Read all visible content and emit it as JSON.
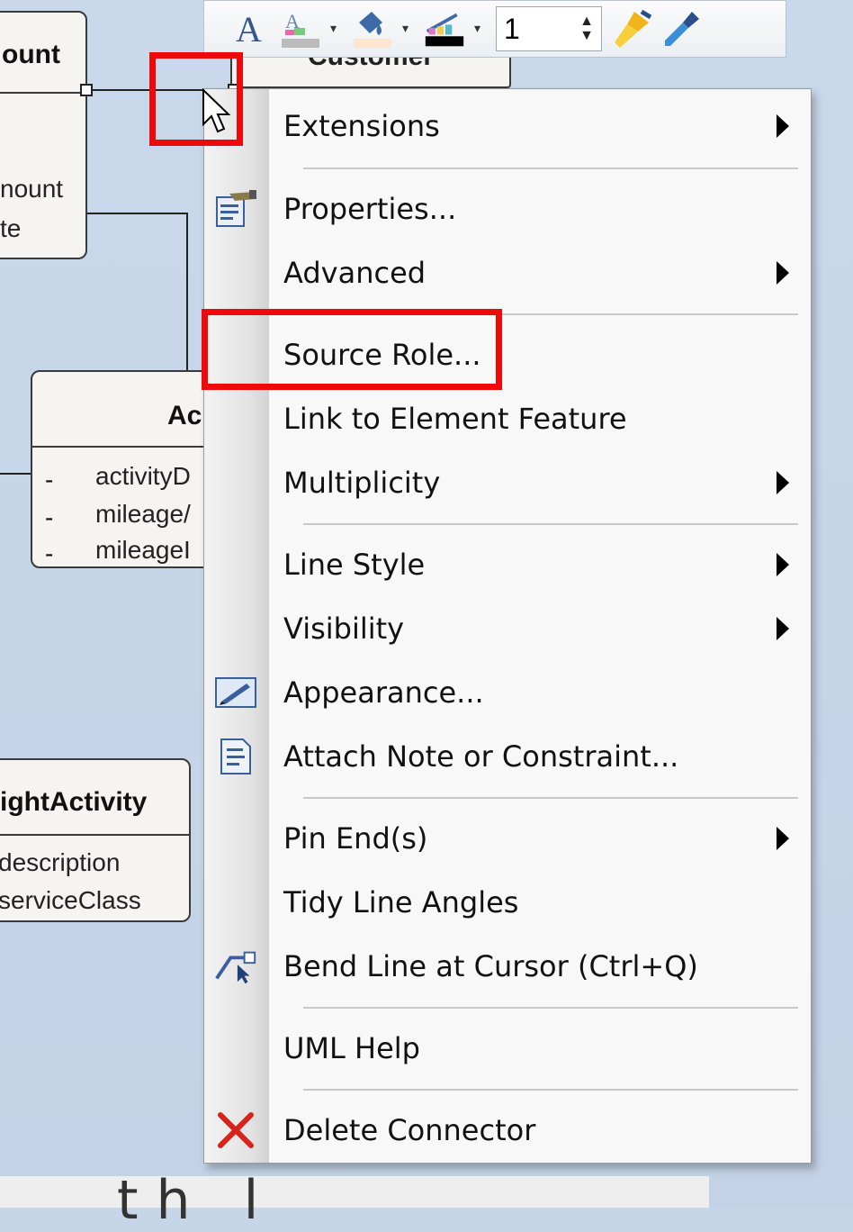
{
  "toolbar": {
    "line_width_value": "1",
    "icons": [
      "font-icon",
      "font-color-icon",
      "fill-color-icon",
      "line-color-icon",
      "line-width-spinner",
      "format-painter-icon",
      "eyedropper-icon"
    ]
  },
  "diagram": {
    "class_account": {
      "name_partial": "ount",
      "attrs_partial": [
        "nount",
        "te"
      ]
    },
    "class_customer": {
      "name_partial": "Customer"
    },
    "class_activity": {
      "name_partial": "Ac",
      "attrs": [
        "activityD",
        "mileage/",
        "mileageI"
      ],
      "dash": "-"
    },
    "class_flight_activity": {
      "name_partial": "ightActivity",
      "attrs": [
        "description",
        "serviceClass"
      ]
    }
  },
  "menu": {
    "items": [
      {
        "label": "Extensions",
        "submenu": true
      },
      {
        "label": "Properties...",
        "submenu": false,
        "icon": "properties-icon"
      },
      {
        "label": "Advanced",
        "submenu": true
      },
      {
        "label": "Source Role...",
        "submenu": false,
        "highlighted": true
      },
      {
        "label": "Link to Element Feature",
        "submenu": false
      },
      {
        "label": "Multiplicity",
        "submenu": true
      },
      {
        "label": "Line Style",
        "submenu": true
      },
      {
        "label": "Visibility",
        "submenu": true
      },
      {
        "label": "Appearance...",
        "submenu": false,
        "icon": "appearance-icon"
      },
      {
        "label": "Attach Note or Constraint...",
        "submenu": false,
        "icon": "note-icon"
      },
      {
        "label": "Pin End(s)",
        "submenu": true
      },
      {
        "label": "Tidy Line Angles",
        "submenu": false
      },
      {
        "label": "Bend Line at Cursor (Ctrl+Q)",
        "submenu": false,
        "icon": "bend-line-icon"
      },
      {
        "label": "UML Help",
        "submenu": false
      },
      {
        "label": "Delete Connector",
        "submenu": false,
        "icon": "delete-x-icon"
      }
    ]
  },
  "caption": {
    "partial_text": "th        l"
  },
  "colors": {
    "highlight_red": "#ee0a0a",
    "canvas_blue": "#c6d5e8",
    "menu_bg": "#f8f8f8"
  }
}
